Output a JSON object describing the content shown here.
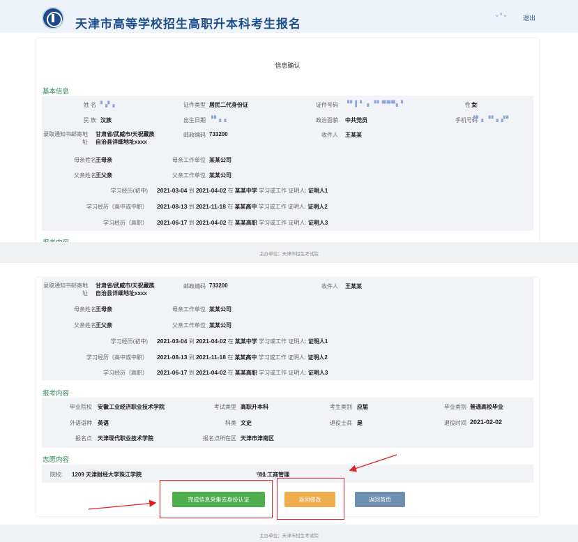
{
  "header": {
    "site_title": "天津市高等学校招生高职升本科考生报名",
    "user_name_masked": "ᵕ°ᵕ",
    "logout": "退出"
  },
  "page": {
    "title": "信息确认"
  },
  "basic": {
    "section_title": "基本信息",
    "name_label": "姓 名",
    "name_value": "▘▞ ▖",
    "id_type_label": "证件类型",
    "id_type_value": "居民二代身份证",
    "id_no_label": "证件号码",
    "id_no_value": "▝▘▌▘ ▖▝▘▀▀▀▖▘",
    "gender_label": "性 别",
    "gender_value": "女",
    "ethnicity_label": "民 族",
    "ethnicity_value": "汉族",
    "birth_label": "出生日期",
    "birth_value": "▝▘▖▖",
    "politics_label": "政治面貌",
    "politics_value": "中共党员",
    "phone_label": "手机号码",
    "phone_value": "▝▘▖▝▘▖▞▘",
    "mail_addr_label": "录取通知书邮寄地址",
    "mail_addr_value": "甘肃省/武威市/天祝藏族自治县详细地址xxxx",
    "postcode_label": "邮政编码",
    "postcode_value": "733200",
    "recipient_label": "收件人",
    "recipient_value": "王某某",
    "mother_name_label": "母亲姓名",
    "mother_name_value": "王母亲",
    "mother_work_label": "母亲工作单位",
    "mother_work_value": "某某公司",
    "father_name_label": "父亲姓名",
    "father_name_value": "王父亲",
    "father_work_label": "父亲工作单位",
    "father_work_value": "某某公司",
    "histories": [
      {
        "label": "学习经历(初中)",
        "from": "2021-03-04",
        "to_word": "到",
        "to": "2021-04-02",
        "at_word": "在",
        "school": "某某中学",
        "mid": "学习或工作 证明人:",
        "witness": "证明人1"
      },
      {
        "label": "学习经历（高中或中职）",
        "from": "2021-08-13",
        "to_word": "到",
        "to": "2021-11-18",
        "at_word": "在",
        "school": "某某高中",
        "mid": "学习或工作 证明人:",
        "witness": "证明人2"
      },
      {
        "label": "学习经历（高职）",
        "from": "2021-06-17",
        "to_word": "到",
        "to": "2021-04-02",
        "at_word": "在",
        "school": "某某高职",
        "mid": "学习或工作 证明人:",
        "witness": "证明人3"
      }
    ]
  },
  "apply": {
    "section_title": "报考内容",
    "grad_school_label": "毕业院校",
    "grad_school_value": "安徽工业经济职业技术学院",
    "exam_type_label": "考试类型",
    "exam_type_value": "高职升本科",
    "candidate_type_label": "考生类别",
    "candidate_type_value": "应届",
    "grad_type_label": "毕业类别",
    "grad_type_value": "普通高校毕业",
    "foreign_lang_label": "外语语种",
    "foreign_lang_value": "英语",
    "subject_label": "科类",
    "subject_value": "文史",
    "veteran_label": "退役士兵",
    "veteran_value": "是",
    "retire_time_label": "退役时间",
    "retire_time_value": "2021-02-02",
    "site_label": "报名点",
    "site_value": "天津现代职业技术学院",
    "site_area_label": "报名点所在区",
    "site_area_value": "天津市津南区"
  },
  "wish": {
    "section_title": "志愿内容",
    "college_label": "院校:",
    "college_value": "1209 天津财经大学珠江学院",
    "major_label": "专业:",
    "major_value": "01 工商管理"
  },
  "buttons": {
    "complete": "完成信息采集去身份认证",
    "back_edit": "返回修改",
    "home": "返回首页"
  },
  "footer": {
    "text": "主办单位：天津市招生考试院"
  },
  "colors": {
    "accent_blue": "#1f4e8c",
    "section_green": "#2e8b57",
    "button_green": "#4cae4c",
    "button_orange": "#f0ad4e",
    "button_blue": "#6f8fb1",
    "annotation_red": "#e02020"
  }
}
